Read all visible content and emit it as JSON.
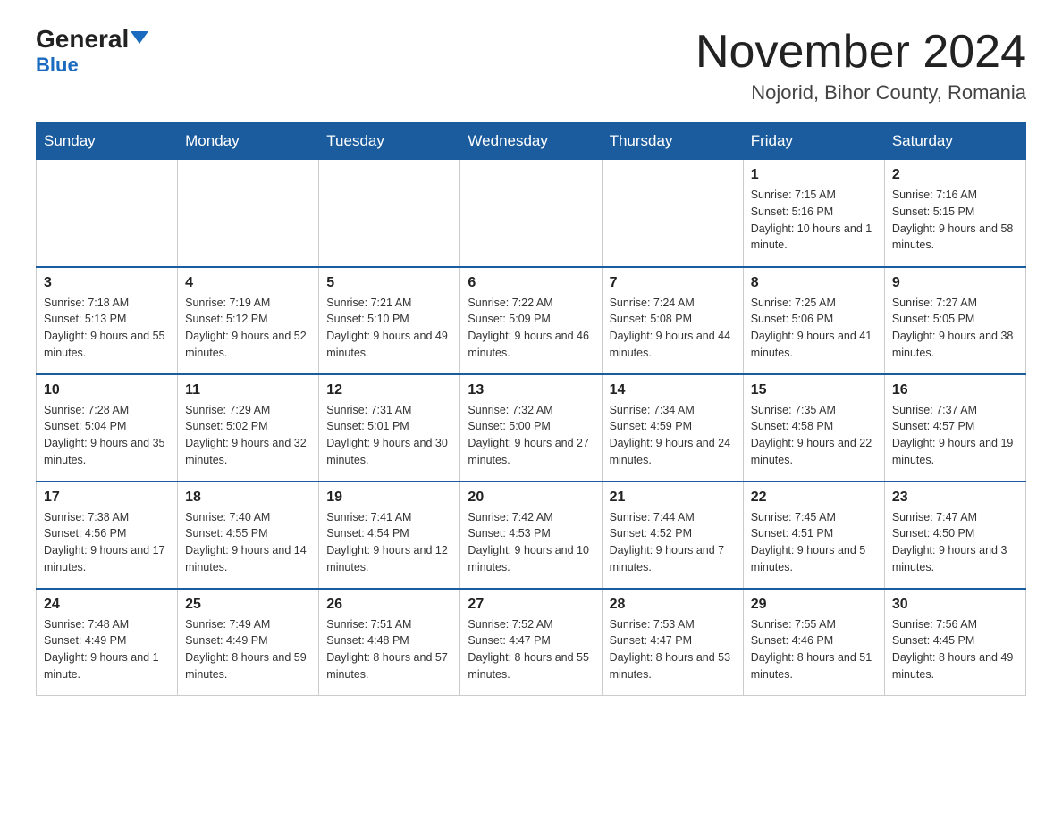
{
  "logo": {
    "general": "General",
    "blue": "Blue"
  },
  "title": "November 2024",
  "location": "Nojorid, Bihor County, Romania",
  "weekdays": [
    "Sunday",
    "Monday",
    "Tuesday",
    "Wednesday",
    "Thursday",
    "Friday",
    "Saturday"
  ],
  "weeks": [
    [
      {
        "day": "",
        "sunrise": "",
        "sunset": "",
        "daylight": ""
      },
      {
        "day": "",
        "sunrise": "",
        "sunset": "",
        "daylight": ""
      },
      {
        "day": "",
        "sunrise": "",
        "sunset": "",
        "daylight": ""
      },
      {
        "day": "",
        "sunrise": "",
        "sunset": "",
        "daylight": ""
      },
      {
        "day": "",
        "sunrise": "",
        "sunset": "",
        "daylight": ""
      },
      {
        "day": "1",
        "sunrise": "Sunrise: 7:15 AM",
        "sunset": "Sunset: 5:16 PM",
        "daylight": "Daylight: 10 hours and 1 minute."
      },
      {
        "day": "2",
        "sunrise": "Sunrise: 7:16 AM",
        "sunset": "Sunset: 5:15 PM",
        "daylight": "Daylight: 9 hours and 58 minutes."
      }
    ],
    [
      {
        "day": "3",
        "sunrise": "Sunrise: 7:18 AM",
        "sunset": "Sunset: 5:13 PM",
        "daylight": "Daylight: 9 hours and 55 minutes."
      },
      {
        "day": "4",
        "sunrise": "Sunrise: 7:19 AM",
        "sunset": "Sunset: 5:12 PM",
        "daylight": "Daylight: 9 hours and 52 minutes."
      },
      {
        "day": "5",
        "sunrise": "Sunrise: 7:21 AM",
        "sunset": "Sunset: 5:10 PM",
        "daylight": "Daylight: 9 hours and 49 minutes."
      },
      {
        "day": "6",
        "sunrise": "Sunrise: 7:22 AM",
        "sunset": "Sunset: 5:09 PM",
        "daylight": "Daylight: 9 hours and 46 minutes."
      },
      {
        "day": "7",
        "sunrise": "Sunrise: 7:24 AM",
        "sunset": "Sunset: 5:08 PM",
        "daylight": "Daylight: 9 hours and 44 minutes."
      },
      {
        "day": "8",
        "sunrise": "Sunrise: 7:25 AM",
        "sunset": "Sunset: 5:06 PM",
        "daylight": "Daylight: 9 hours and 41 minutes."
      },
      {
        "day": "9",
        "sunrise": "Sunrise: 7:27 AM",
        "sunset": "Sunset: 5:05 PM",
        "daylight": "Daylight: 9 hours and 38 minutes."
      }
    ],
    [
      {
        "day": "10",
        "sunrise": "Sunrise: 7:28 AM",
        "sunset": "Sunset: 5:04 PM",
        "daylight": "Daylight: 9 hours and 35 minutes."
      },
      {
        "day": "11",
        "sunrise": "Sunrise: 7:29 AM",
        "sunset": "Sunset: 5:02 PM",
        "daylight": "Daylight: 9 hours and 32 minutes."
      },
      {
        "day": "12",
        "sunrise": "Sunrise: 7:31 AM",
        "sunset": "Sunset: 5:01 PM",
        "daylight": "Daylight: 9 hours and 30 minutes."
      },
      {
        "day": "13",
        "sunrise": "Sunrise: 7:32 AM",
        "sunset": "Sunset: 5:00 PM",
        "daylight": "Daylight: 9 hours and 27 minutes."
      },
      {
        "day": "14",
        "sunrise": "Sunrise: 7:34 AM",
        "sunset": "Sunset: 4:59 PM",
        "daylight": "Daylight: 9 hours and 24 minutes."
      },
      {
        "day": "15",
        "sunrise": "Sunrise: 7:35 AM",
        "sunset": "Sunset: 4:58 PM",
        "daylight": "Daylight: 9 hours and 22 minutes."
      },
      {
        "day": "16",
        "sunrise": "Sunrise: 7:37 AM",
        "sunset": "Sunset: 4:57 PM",
        "daylight": "Daylight: 9 hours and 19 minutes."
      }
    ],
    [
      {
        "day": "17",
        "sunrise": "Sunrise: 7:38 AM",
        "sunset": "Sunset: 4:56 PM",
        "daylight": "Daylight: 9 hours and 17 minutes."
      },
      {
        "day": "18",
        "sunrise": "Sunrise: 7:40 AM",
        "sunset": "Sunset: 4:55 PM",
        "daylight": "Daylight: 9 hours and 14 minutes."
      },
      {
        "day": "19",
        "sunrise": "Sunrise: 7:41 AM",
        "sunset": "Sunset: 4:54 PM",
        "daylight": "Daylight: 9 hours and 12 minutes."
      },
      {
        "day": "20",
        "sunrise": "Sunrise: 7:42 AM",
        "sunset": "Sunset: 4:53 PM",
        "daylight": "Daylight: 9 hours and 10 minutes."
      },
      {
        "day": "21",
        "sunrise": "Sunrise: 7:44 AM",
        "sunset": "Sunset: 4:52 PM",
        "daylight": "Daylight: 9 hours and 7 minutes."
      },
      {
        "day": "22",
        "sunrise": "Sunrise: 7:45 AM",
        "sunset": "Sunset: 4:51 PM",
        "daylight": "Daylight: 9 hours and 5 minutes."
      },
      {
        "day": "23",
        "sunrise": "Sunrise: 7:47 AM",
        "sunset": "Sunset: 4:50 PM",
        "daylight": "Daylight: 9 hours and 3 minutes."
      }
    ],
    [
      {
        "day": "24",
        "sunrise": "Sunrise: 7:48 AM",
        "sunset": "Sunset: 4:49 PM",
        "daylight": "Daylight: 9 hours and 1 minute."
      },
      {
        "day": "25",
        "sunrise": "Sunrise: 7:49 AM",
        "sunset": "Sunset: 4:49 PM",
        "daylight": "Daylight: 8 hours and 59 minutes."
      },
      {
        "day": "26",
        "sunrise": "Sunrise: 7:51 AM",
        "sunset": "Sunset: 4:48 PM",
        "daylight": "Daylight: 8 hours and 57 minutes."
      },
      {
        "day": "27",
        "sunrise": "Sunrise: 7:52 AM",
        "sunset": "Sunset: 4:47 PM",
        "daylight": "Daylight: 8 hours and 55 minutes."
      },
      {
        "day": "28",
        "sunrise": "Sunrise: 7:53 AM",
        "sunset": "Sunset: 4:47 PM",
        "daylight": "Daylight: 8 hours and 53 minutes."
      },
      {
        "day": "29",
        "sunrise": "Sunrise: 7:55 AM",
        "sunset": "Sunset: 4:46 PM",
        "daylight": "Daylight: 8 hours and 51 minutes."
      },
      {
        "day": "30",
        "sunrise": "Sunrise: 7:56 AM",
        "sunset": "Sunset: 4:45 PM",
        "daylight": "Daylight: 8 hours and 49 minutes."
      }
    ]
  ]
}
